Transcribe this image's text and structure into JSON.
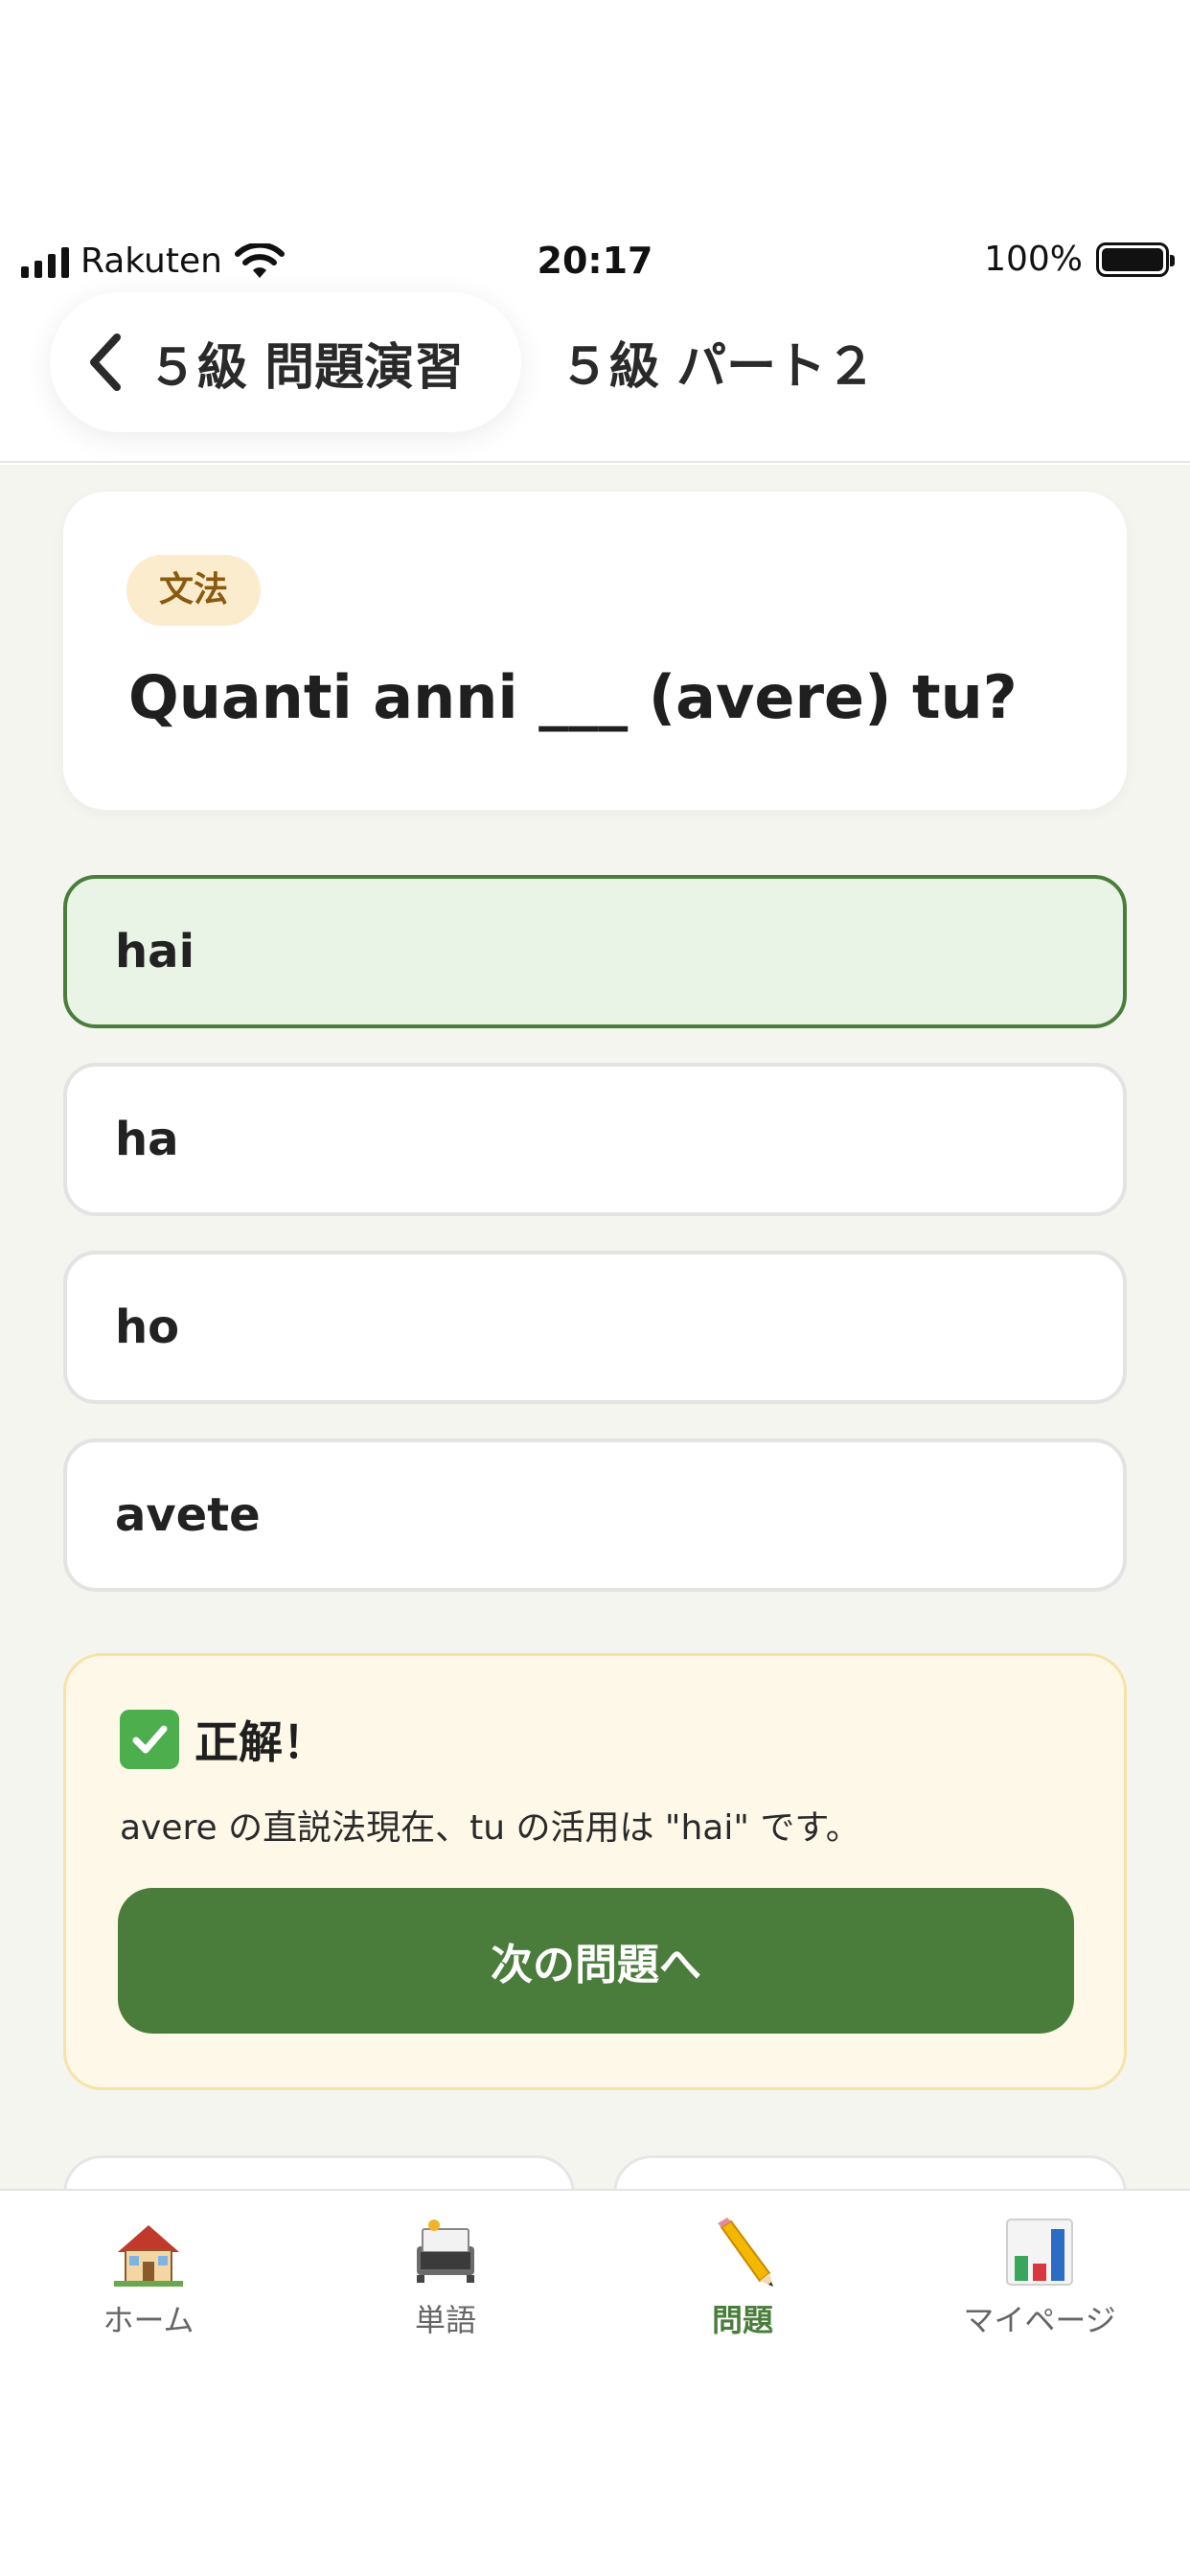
{
  "status_bar": {
    "carrier": "Rakuten",
    "time": "20:17",
    "battery": "100%"
  },
  "nav": {
    "back_label": "５級 問題演習",
    "title": "５級 パート２"
  },
  "question": {
    "tag": "文法",
    "text": "Quanti anni ___ (avere) tu?"
  },
  "options": [
    {
      "label": "hai",
      "state": "correct"
    },
    {
      "label": "ha",
      "state": "default"
    },
    {
      "label": "ho",
      "state": "default"
    },
    {
      "label": "avete",
      "state": "default"
    }
  ],
  "feedback": {
    "title": "正解！",
    "explanation": "avere の直説法現在、tu の活用は \"hai\" です。",
    "next_button": "次の問題へ"
  },
  "tabbar": {
    "items": [
      {
        "label": "ホーム",
        "icon": "house-icon"
      },
      {
        "label": "単語",
        "icon": "card-index-icon"
      },
      {
        "label": "問題",
        "icon": "pencil-icon"
      },
      {
        "label": "マイページ",
        "icon": "bar-chart-icon"
      }
    ],
    "active_index": 2
  },
  "colors": {
    "accent": "#4a7d3c",
    "content_bg": "#f4f5ef",
    "correct_bg": "#e9f3e6",
    "feedback_bg": "#fdf8e8",
    "tag_bg": "#fbeccd"
  }
}
